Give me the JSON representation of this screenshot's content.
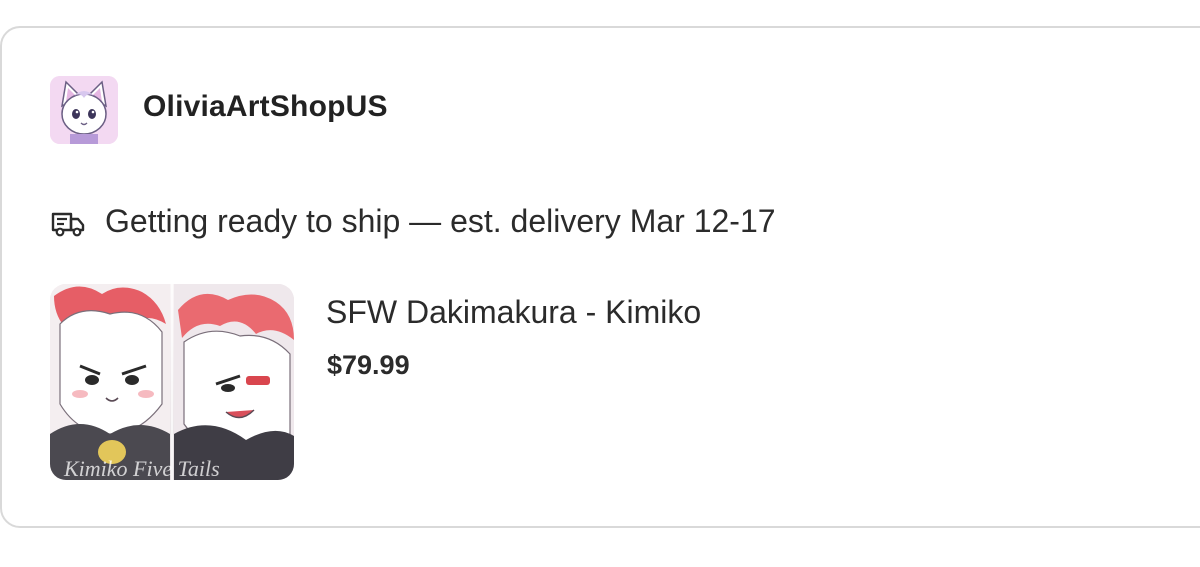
{
  "shop": {
    "name": "OliviaArtShopUS",
    "avatar_icon": "cat-avatar-icon"
  },
  "shipping": {
    "icon": "delivery-truck-icon",
    "status_text": "Getting ready to ship — est. delivery Mar 12-17"
  },
  "product": {
    "title": "SFW Dakimakura - Kimiko",
    "price": "$79.99",
    "image_watermark": "Kimiko Five Tails"
  },
  "colors": {
    "card_border": "#d9d9d9",
    "text": "#222222",
    "avatar_bg": "#f2d7f0",
    "accent_pink": "#e9575e"
  }
}
